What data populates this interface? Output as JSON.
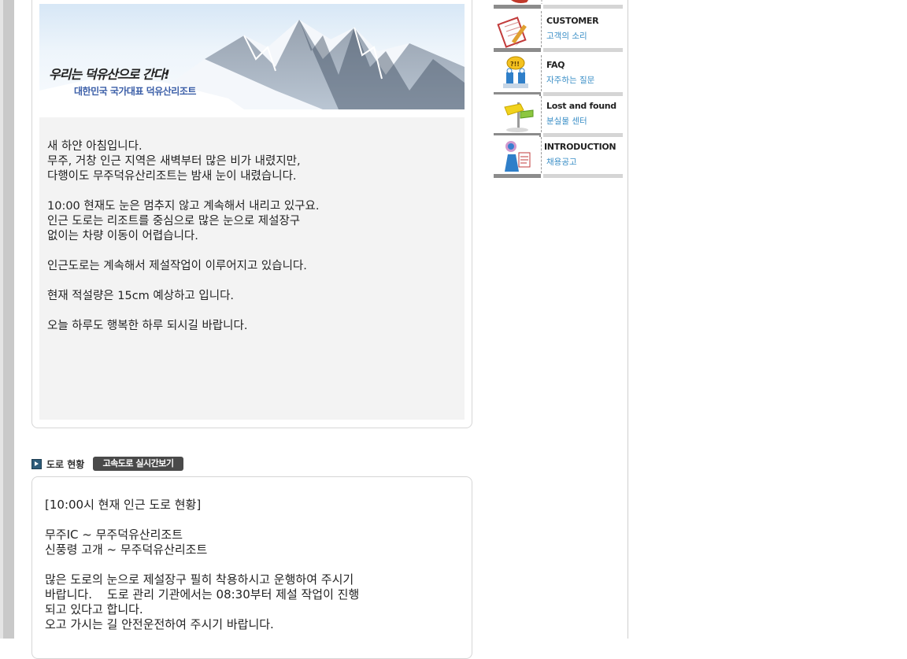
{
  "banner": {
    "title": "우리는 덕유산으로 간다!",
    "subtitle": "대한민국 국가대표 덕유산리조트"
  },
  "notice": {
    "paragraphs": [
      [
        "새 하얀 아침입니다.",
        "무주, 거창 인근 지역은 새벽부터 많은 비가 내렸지만,",
        "다행이도 무주덕유산리조트는 밤새 눈이 내렸습니다."
      ],
      [
        "10:00 현재도 눈은 멈추지 않고 계속해서 내리고 있구요.",
        "인근 도로는 리조트를 중심으로 많은 눈으로 제설장구",
        "없이는 차량 이동이 어렵습니다."
      ],
      [
        "인근도로는 계속해서 제설작업이 이루어지고 있습니다."
      ],
      [
        "현재 적설량은 15cm 예상하고 입니다."
      ],
      [
        "오늘 하루도 행복한 하루 되시길 바랍니다."
      ]
    ]
  },
  "road": {
    "section_title": "도로 현황",
    "live_button": "고속도로 실시간보기",
    "paragraphs": [
      [
        "[10:00시 현재 인근 도로 현황]"
      ],
      [
        "무주IC ~ 무주덕유산리조트",
        "신풍령 고개 ~ 무주덕유산리조트"
      ],
      [
        "많은 도로의 눈으로 제설장구 필히 착용하시고 운행하여 주시기",
        "바랍니다.    도로 관리 기관에서는 08:30부터 제설 작업이 진행",
        "되고 있다고 합니다.",
        "오고 가시는 길 안전운전하여 주시기 바랍니다."
      ]
    ]
  },
  "side_menu": {
    "items": [
      {
        "en": "CUSTOMER",
        "ko": "고객의 소리",
        "icon": "notepad-pencil-icon"
      },
      {
        "en": "FAQ",
        "ko": "자주하는 질문",
        "icon": "question-person-icon"
      },
      {
        "en": "Lost and found",
        "ko": "분실물 센터",
        "icon": "signpost-icon"
      },
      {
        "en": "INTRODUCTION",
        "ko": "채용공고",
        "icon": "person-chart-icon"
      }
    ]
  }
}
